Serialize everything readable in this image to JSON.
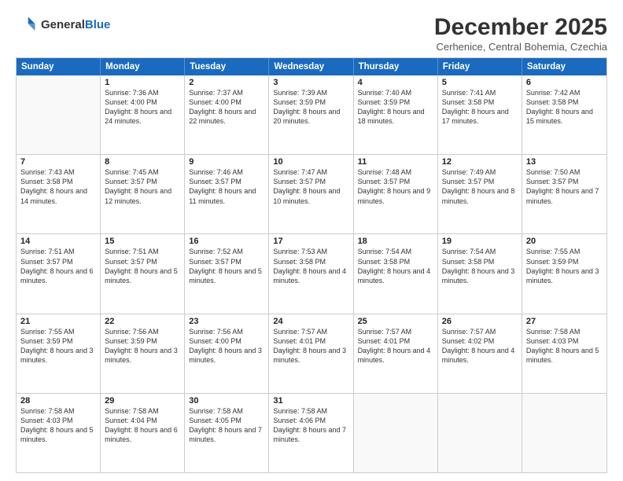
{
  "header": {
    "logo_general": "General",
    "logo_blue": "Blue",
    "main_title": "December 2025",
    "subtitle": "Cerhenice, Central Bohemia, Czechia"
  },
  "calendar": {
    "days_of_week": [
      "Sunday",
      "Monday",
      "Tuesday",
      "Wednesday",
      "Thursday",
      "Friday",
      "Saturday"
    ],
    "rows": [
      [
        {
          "day": "",
          "sunrise": "",
          "sunset": "",
          "daylight": ""
        },
        {
          "day": "1",
          "sunrise": "Sunrise: 7:36 AM",
          "sunset": "Sunset: 4:00 PM",
          "daylight": "Daylight: 8 hours and 24 minutes."
        },
        {
          "day": "2",
          "sunrise": "Sunrise: 7:37 AM",
          "sunset": "Sunset: 4:00 PM",
          "daylight": "Daylight: 8 hours and 22 minutes."
        },
        {
          "day": "3",
          "sunrise": "Sunrise: 7:39 AM",
          "sunset": "Sunset: 3:59 PM",
          "daylight": "Daylight: 8 hours and 20 minutes."
        },
        {
          "day": "4",
          "sunrise": "Sunrise: 7:40 AM",
          "sunset": "Sunset: 3:59 PM",
          "daylight": "Daylight: 8 hours and 18 minutes."
        },
        {
          "day": "5",
          "sunrise": "Sunrise: 7:41 AM",
          "sunset": "Sunset: 3:58 PM",
          "daylight": "Daylight: 8 hours and 17 minutes."
        },
        {
          "day": "6",
          "sunrise": "Sunrise: 7:42 AM",
          "sunset": "Sunset: 3:58 PM",
          "daylight": "Daylight: 8 hours and 15 minutes."
        }
      ],
      [
        {
          "day": "7",
          "sunrise": "Sunrise: 7:43 AM",
          "sunset": "Sunset: 3:58 PM",
          "daylight": "Daylight: 8 hours and 14 minutes."
        },
        {
          "day": "8",
          "sunrise": "Sunrise: 7:45 AM",
          "sunset": "Sunset: 3:57 PM",
          "daylight": "Daylight: 8 hours and 12 minutes."
        },
        {
          "day": "9",
          "sunrise": "Sunrise: 7:46 AM",
          "sunset": "Sunset: 3:57 PM",
          "daylight": "Daylight: 8 hours and 11 minutes."
        },
        {
          "day": "10",
          "sunrise": "Sunrise: 7:47 AM",
          "sunset": "Sunset: 3:57 PM",
          "daylight": "Daylight: 8 hours and 10 minutes."
        },
        {
          "day": "11",
          "sunrise": "Sunrise: 7:48 AM",
          "sunset": "Sunset: 3:57 PM",
          "daylight": "Daylight: 8 hours and 9 minutes."
        },
        {
          "day": "12",
          "sunrise": "Sunrise: 7:49 AM",
          "sunset": "Sunset: 3:57 PM",
          "daylight": "Daylight: 8 hours and 8 minutes."
        },
        {
          "day": "13",
          "sunrise": "Sunrise: 7:50 AM",
          "sunset": "Sunset: 3:57 PM",
          "daylight": "Daylight: 8 hours and 7 minutes."
        }
      ],
      [
        {
          "day": "14",
          "sunrise": "Sunrise: 7:51 AM",
          "sunset": "Sunset: 3:57 PM",
          "daylight": "Daylight: 8 hours and 6 minutes."
        },
        {
          "day": "15",
          "sunrise": "Sunrise: 7:51 AM",
          "sunset": "Sunset: 3:57 PM",
          "daylight": "Daylight: 8 hours and 5 minutes."
        },
        {
          "day": "16",
          "sunrise": "Sunrise: 7:52 AM",
          "sunset": "Sunset: 3:57 PM",
          "daylight": "Daylight: 8 hours and 5 minutes."
        },
        {
          "day": "17",
          "sunrise": "Sunrise: 7:53 AM",
          "sunset": "Sunset: 3:58 PM",
          "daylight": "Daylight: 8 hours and 4 minutes."
        },
        {
          "day": "18",
          "sunrise": "Sunrise: 7:54 AM",
          "sunset": "Sunset: 3:58 PM",
          "daylight": "Daylight: 8 hours and 4 minutes."
        },
        {
          "day": "19",
          "sunrise": "Sunrise: 7:54 AM",
          "sunset": "Sunset: 3:58 PM",
          "daylight": "Daylight: 8 hours and 3 minutes."
        },
        {
          "day": "20",
          "sunrise": "Sunrise: 7:55 AM",
          "sunset": "Sunset: 3:59 PM",
          "daylight": "Daylight: 8 hours and 3 minutes."
        }
      ],
      [
        {
          "day": "21",
          "sunrise": "Sunrise: 7:55 AM",
          "sunset": "Sunset: 3:59 PM",
          "daylight": "Daylight: 8 hours and 3 minutes."
        },
        {
          "day": "22",
          "sunrise": "Sunrise: 7:56 AM",
          "sunset": "Sunset: 3:59 PM",
          "daylight": "Daylight: 8 hours and 3 minutes."
        },
        {
          "day": "23",
          "sunrise": "Sunrise: 7:56 AM",
          "sunset": "Sunset: 4:00 PM",
          "daylight": "Daylight: 8 hours and 3 minutes."
        },
        {
          "day": "24",
          "sunrise": "Sunrise: 7:57 AM",
          "sunset": "Sunset: 4:01 PM",
          "daylight": "Daylight: 8 hours and 3 minutes."
        },
        {
          "day": "25",
          "sunrise": "Sunrise: 7:57 AM",
          "sunset": "Sunset: 4:01 PM",
          "daylight": "Daylight: 8 hours and 4 minutes."
        },
        {
          "day": "26",
          "sunrise": "Sunrise: 7:57 AM",
          "sunset": "Sunset: 4:02 PM",
          "daylight": "Daylight: 8 hours and 4 minutes."
        },
        {
          "day": "27",
          "sunrise": "Sunrise: 7:58 AM",
          "sunset": "Sunset: 4:03 PM",
          "daylight": "Daylight: 8 hours and 5 minutes."
        }
      ],
      [
        {
          "day": "28",
          "sunrise": "Sunrise: 7:58 AM",
          "sunset": "Sunset: 4:03 PM",
          "daylight": "Daylight: 8 hours and 5 minutes."
        },
        {
          "day": "29",
          "sunrise": "Sunrise: 7:58 AM",
          "sunset": "Sunset: 4:04 PM",
          "daylight": "Daylight: 8 hours and 6 minutes."
        },
        {
          "day": "30",
          "sunrise": "Sunrise: 7:58 AM",
          "sunset": "Sunset: 4:05 PM",
          "daylight": "Daylight: 8 hours and 7 minutes."
        },
        {
          "day": "31",
          "sunrise": "Sunrise: 7:58 AM",
          "sunset": "Sunset: 4:06 PM",
          "daylight": "Daylight: 8 hours and 7 minutes."
        },
        {
          "day": "",
          "sunrise": "",
          "sunset": "",
          "daylight": ""
        },
        {
          "day": "",
          "sunrise": "",
          "sunset": "",
          "daylight": ""
        },
        {
          "day": "",
          "sunrise": "",
          "sunset": "",
          "daylight": ""
        }
      ]
    ]
  }
}
